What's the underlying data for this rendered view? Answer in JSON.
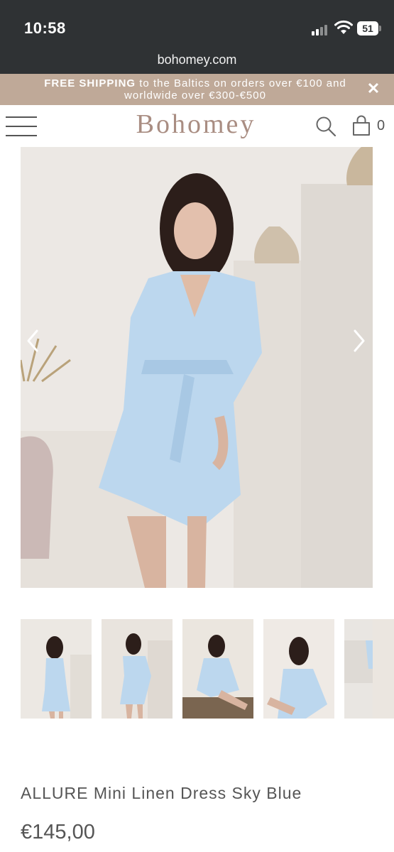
{
  "status_bar": {
    "time": "10:58",
    "battery": "51",
    "icons": [
      "cellular-signal-icon",
      "wifi-icon",
      "battery-icon"
    ]
  },
  "browser": {
    "url": "bohomey.com"
  },
  "promo": {
    "bold_text": "FREE SHIPPING",
    "text": " to the Baltics on orders over €100 and worldwide over €300-€500",
    "close_icon": "close-icon"
  },
  "header": {
    "logo": "Bohomey",
    "cart_count": "0",
    "icons": [
      "menu-icon",
      "search-icon",
      "shopping-bag-icon"
    ]
  },
  "gallery": {
    "main_image": "model wearing sky blue linen wrap mini dress",
    "thumbnails": 5,
    "icons": [
      "chevron-left-icon",
      "chevron-right-icon"
    ]
  },
  "product": {
    "title": "ALLURE Mini Linen Dress Sky Blue",
    "price": "€145,00"
  },
  "colors": {
    "status_bar": "#2f3234",
    "promo_bg": "#bfa998",
    "logo": "#a98d82",
    "dress": "#bcd7ee"
  }
}
